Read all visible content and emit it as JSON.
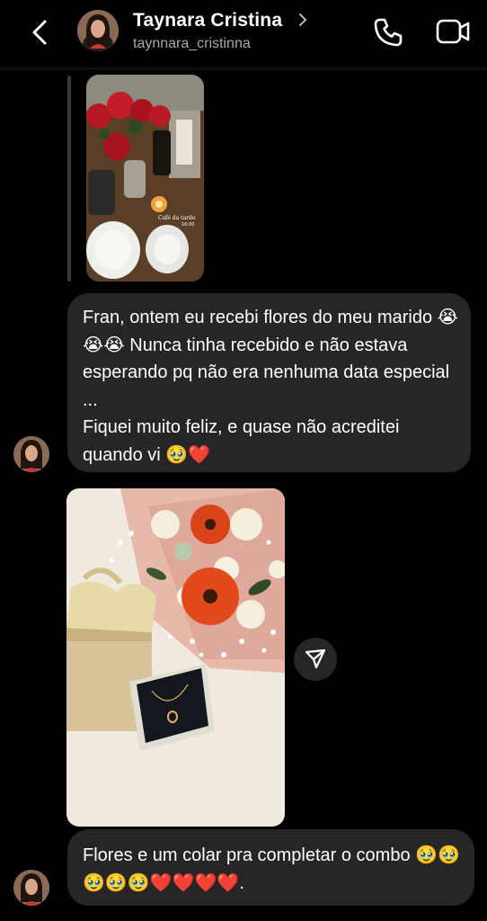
{
  "header": {
    "contact_name": "Taynara Cristina",
    "username": "taynnara_cristinna",
    "icons": [
      "back-arrow-icon",
      "chevron-right-icon",
      "phone-icon",
      "video-camera-icon"
    ]
  },
  "story_reply": {
    "image_caption": "Café da tarde",
    "image_subcaption": "16:00"
  },
  "messages": [
    {
      "type": "text",
      "text": "Fran, ontem eu recebi flores do meu marido 😭😭😭 Nunca tinha recebido e não estava esperando pq não era nenhuma data especial ...\nFiquei muito feliz, e quase não acreditei quando vi 🥹❤️"
    },
    {
      "type": "photo"
    },
    {
      "type": "text",
      "text": "Flores e um colar pra completar o combo 🥹🥹🥹🥹🥹❤️❤️❤️❤️."
    }
  ],
  "colors": {
    "background": "#000000",
    "bubble": "#262626",
    "secondary_text": "#a8a8a8",
    "heart": "#e0203a"
  }
}
